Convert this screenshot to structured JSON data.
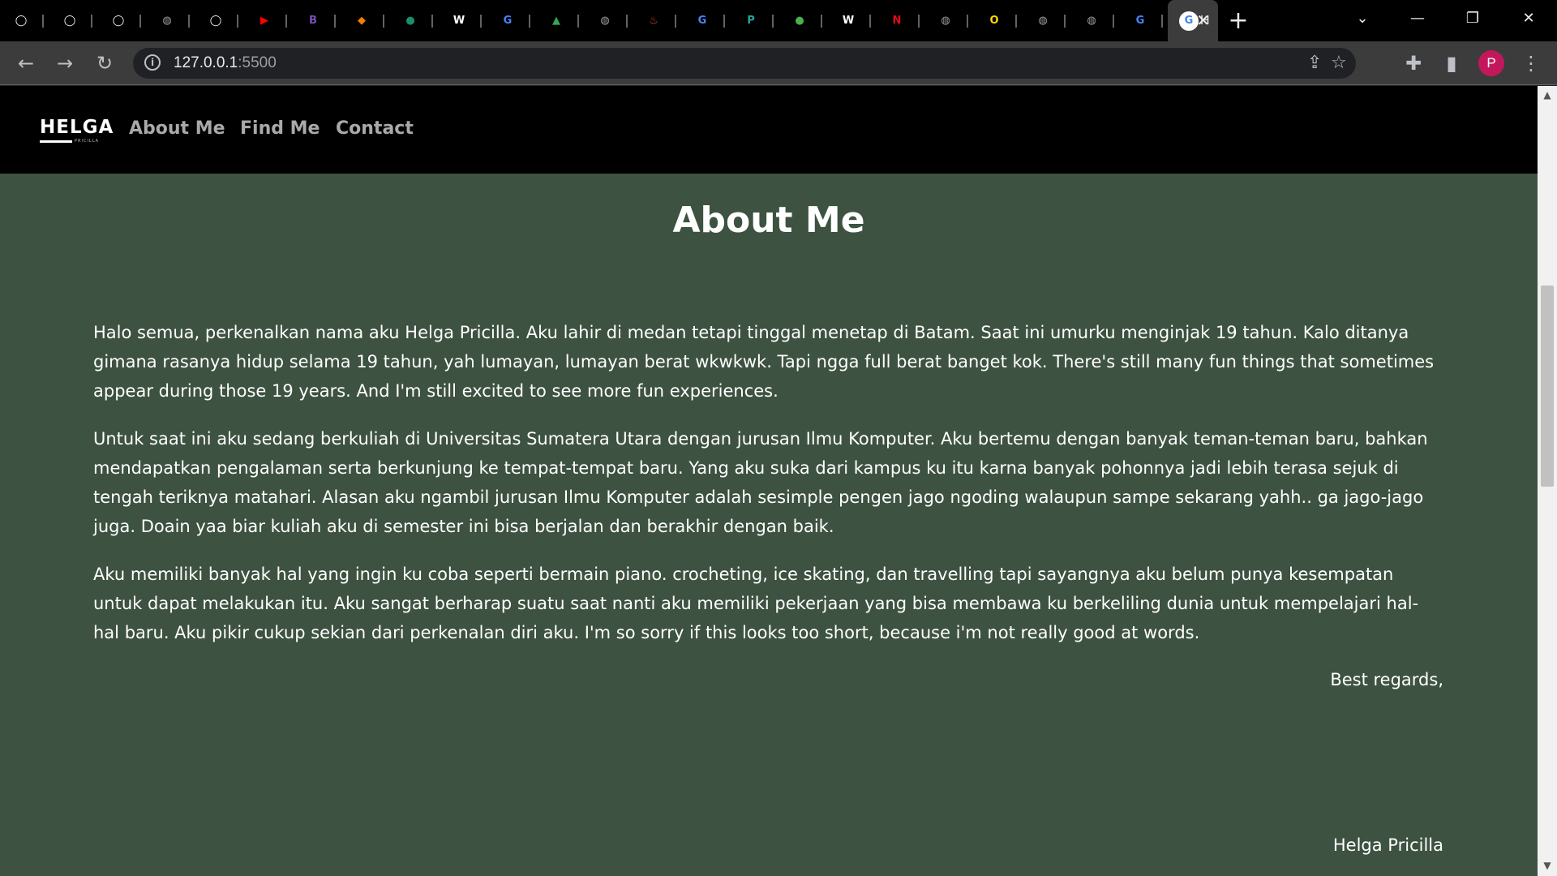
{
  "browser": {
    "tabs": [
      {
        "icon": "github-icon",
        "color": "#ffffff",
        "glyph": "◯"
      },
      {
        "icon": "github-icon",
        "color": "#ffffff",
        "glyph": "◯"
      },
      {
        "icon": "github-icon",
        "color": "#ffffff",
        "glyph": "◯"
      },
      {
        "icon": "globe-icon",
        "color": "#9aa0a6",
        "glyph": "◍"
      },
      {
        "icon": "github-icon",
        "color": "#ffffff",
        "glyph": "◯"
      },
      {
        "icon": "youtube-icon",
        "color": "#ff0000",
        "glyph": "▶"
      },
      {
        "icon": "bootstrap-icon",
        "color": "#7952b3",
        "glyph": "B"
      },
      {
        "icon": "fire-icon",
        "color": "#f57c00",
        "glyph": "◆"
      },
      {
        "icon": "drive-icon",
        "color": "#1a8f6e",
        "glyph": "●"
      },
      {
        "icon": "wikipedia-icon",
        "color": "#ffffff",
        "glyph": "W"
      },
      {
        "icon": "google-icon",
        "color": "#4285f4",
        "glyph": "G"
      },
      {
        "icon": "google-drive-icon",
        "color": "#34a853",
        "glyph": "▲"
      },
      {
        "icon": "globe-icon",
        "color": "#9aa0a6",
        "glyph": "◍"
      },
      {
        "icon": "flame-icon",
        "color": "#e64a19",
        "glyph": "♨"
      },
      {
        "icon": "google-icon",
        "color": "#4285f4",
        "glyph": "G"
      },
      {
        "icon": "app-icon",
        "color": "#26a69a",
        "glyph": "P"
      },
      {
        "icon": "chat-icon",
        "color": "#4caf50",
        "glyph": "●"
      },
      {
        "icon": "wikipedia-icon",
        "color": "#ffffff",
        "glyph": "W"
      },
      {
        "icon": "netflix-icon",
        "color": "#e50914",
        "glyph": "N"
      },
      {
        "icon": "globe-icon",
        "color": "#9aa0a6",
        "glyph": "◍"
      },
      {
        "icon": "oy-icon",
        "color": "#ffd600",
        "glyph": "O"
      },
      {
        "icon": "globe-icon",
        "color": "#9aa0a6",
        "glyph": "◍"
      },
      {
        "icon": "globe-icon",
        "color": "#9aa0a6",
        "glyph": "◍"
      },
      {
        "icon": "google-icon",
        "color": "#4285f4",
        "glyph": "G"
      }
    ],
    "active_tab_text": "H",
    "address": {
      "host": "127.0.0.1",
      "port": ":5500"
    },
    "profile_initial": "P"
  },
  "site": {
    "logo": "HELGA",
    "logo_sub": "PRICILLA",
    "nav": [
      "About Me",
      "Find Me",
      "Contact"
    ]
  },
  "page": {
    "heading": "About Me",
    "paragraphs": [
      "Halo semua, perkenalkan nama aku Helga Pricilla. Aku lahir di medan tetapi tinggal menetap di Batam. Saat ini umurku menginjak 19 tahun. Kalo ditanya gimana rasanya hidup selama 19 tahun, yah lumayan, lumayan berat wkwkwk. Tapi ngga full berat banget kok. There's still many fun things that sometimes appear during those 19 years. And I'm still excited to see more fun experiences.",
      "Untuk saat ini aku sedang berkuliah di Universitas Sumatera Utara dengan jurusan Ilmu Komputer. Aku bertemu dengan banyak teman-teman baru, bahkan mendapatkan pengalaman serta berkunjung ke tempat-tempat baru. Yang aku suka dari kampus ku itu karna banyak pohonnya jadi lebih terasa sejuk di tengah teriknya matahari. Alasan aku ngambil jurusan Ilmu Komputer adalah sesimple pengen jago ngoding walaupun sampe sekarang yahh.. ga jago-jago juga. Doain yaa biar kuliah aku di semester ini bisa berjalan dan berakhir dengan baik.",
      "Aku memiliki banyak hal yang ingin ku coba seperti bermain piano. crocheting, ice skating, dan travelling tapi sayangnya aku belum punya kesempatan untuk dapat melakukan itu. Aku sangat berharap suatu saat nanti aku memiliki pekerjaan yang bisa membawa ku berkeliling dunia untuk mempelajari hal-hal baru. Aku pikir cukup sekian dari perkenalan diri aku. I'm so sorry if this looks too short, because i'm not really good at words."
    ],
    "closing": "Best regards,",
    "signature": "Helga Pricilla"
  }
}
